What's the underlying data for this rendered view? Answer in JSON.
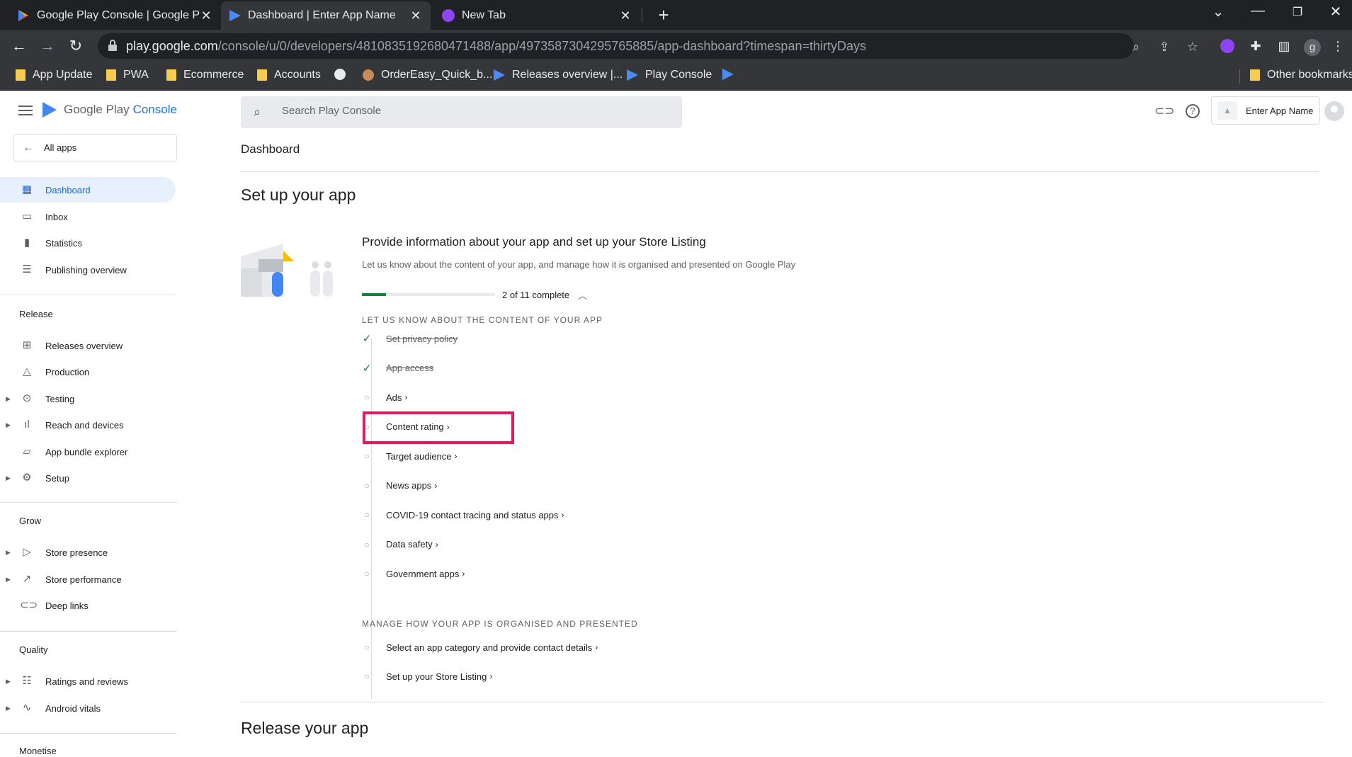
{
  "browser": {
    "tabs": [
      {
        "title": "Google Play Console | Google Pla",
        "active": false
      },
      {
        "title": "Dashboard | Enter App Name",
        "active": true
      },
      {
        "title": "New Tab",
        "active": false
      }
    ],
    "url_host": "play.google.com",
    "url_path": "/console/u/0/developers/4810835192680471488/app/4973587304295765885/app-dashboard?timespan=thirtyDays",
    "profile_initial": "g",
    "bookmarks": [
      "App Update",
      "PWA",
      "Ecommerce",
      "Accounts",
      "OrderEasy_Quick_b...",
      "Releases overview |...",
      "Play Console"
    ],
    "other_bookmarks": "Other bookmarks"
  },
  "app": {
    "logo_google_play": "Google Play",
    "logo_console": "Console",
    "all_apps": "All apps",
    "search_placeholder": "Search Play Console",
    "app_name": "Enter App Name",
    "accent_color": "#1a73e8"
  },
  "sidebar": {
    "top_items": [
      {
        "label": "Dashboard",
        "icon": "dashboard-icon",
        "active": true
      },
      {
        "label": "Inbox",
        "icon": "inbox-icon"
      },
      {
        "label": "Statistics",
        "icon": "bar-chart-icon"
      },
      {
        "label": "Publishing overview",
        "icon": "publishing-icon"
      }
    ],
    "sections": [
      {
        "title": "Release",
        "items": [
          {
            "label": "Releases overview",
            "icon": "releases-icon"
          },
          {
            "label": "Production",
            "icon": "production-icon"
          },
          {
            "label": "Testing",
            "icon": "testing-icon"
          },
          {
            "label": "Reach and devices",
            "icon": "reach-icon"
          },
          {
            "label": "App bundle explorer",
            "icon": "bundle-icon"
          },
          {
            "label": "Setup",
            "icon": "gear-icon"
          }
        ]
      },
      {
        "title": "Grow",
        "items": [
          {
            "label": "Store presence",
            "icon": "play-icon"
          },
          {
            "label": "Store performance",
            "icon": "trending-icon"
          },
          {
            "label": "Deep links",
            "icon": "link-icon"
          }
        ]
      },
      {
        "title": "Quality",
        "items": [
          {
            "label": "Ratings and reviews",
            "icon": "reviews-icon"
          },
          {
            "label": "Android vitals",
            "icon": "vitals-icon"
          }
        ]
      },
      {
        "title": "Monetise",
        "items": []
      }
    ]
  },
  "main": {
    "breadcrumb": "Dashboard",
    "setup_heading": "Set up your app",
    "card_title": "Provide information about your app and set up your Store Listing",
    "card_subtitle": "Let us know about the content of your app, and manage how it is organised and presented on Google Play",
    "progress_text": "2 of 11 complete",
    "progress_fraction": 0.18,
    "group1_title": "LET US KNOW ABOUT THE CONTENT OF YOUR APP",
    "group1_steps": [
      {
        "label": "Set privacy policy",
        "done": true
      },
      {
        "label": "App access",
        "done": true
      },
      {
        "label": "Ads",
        "done": false
      },
      {
        "label": "Content rating",
        "done": false
      },
      {
        "label": "Target audience",
        "done": false
      },
      {
        "label": "News apps",
        "done": false
      },
      {
        "label": "COVID-19 contact tracing and status apps",
        "done": false
      },
      {
        "label": "Data safety",
        "done": false
      },
      {
        "label": "Government apps",
        "done": false
      }
    ],
    "group2_title": "MANAGE HOW YOUR APP IS ORGANISED AND PRESENTED",
    "group2_steps": [
      {
        "label": "Select an app category and provide contact details",
        "done": false
      },
      {
        "label": "Set up your Store Listing",
        "done": false
      }
    ],
    "release_heading": "Release your app",
    "highlight_color": "#e5175f"
  }
}
